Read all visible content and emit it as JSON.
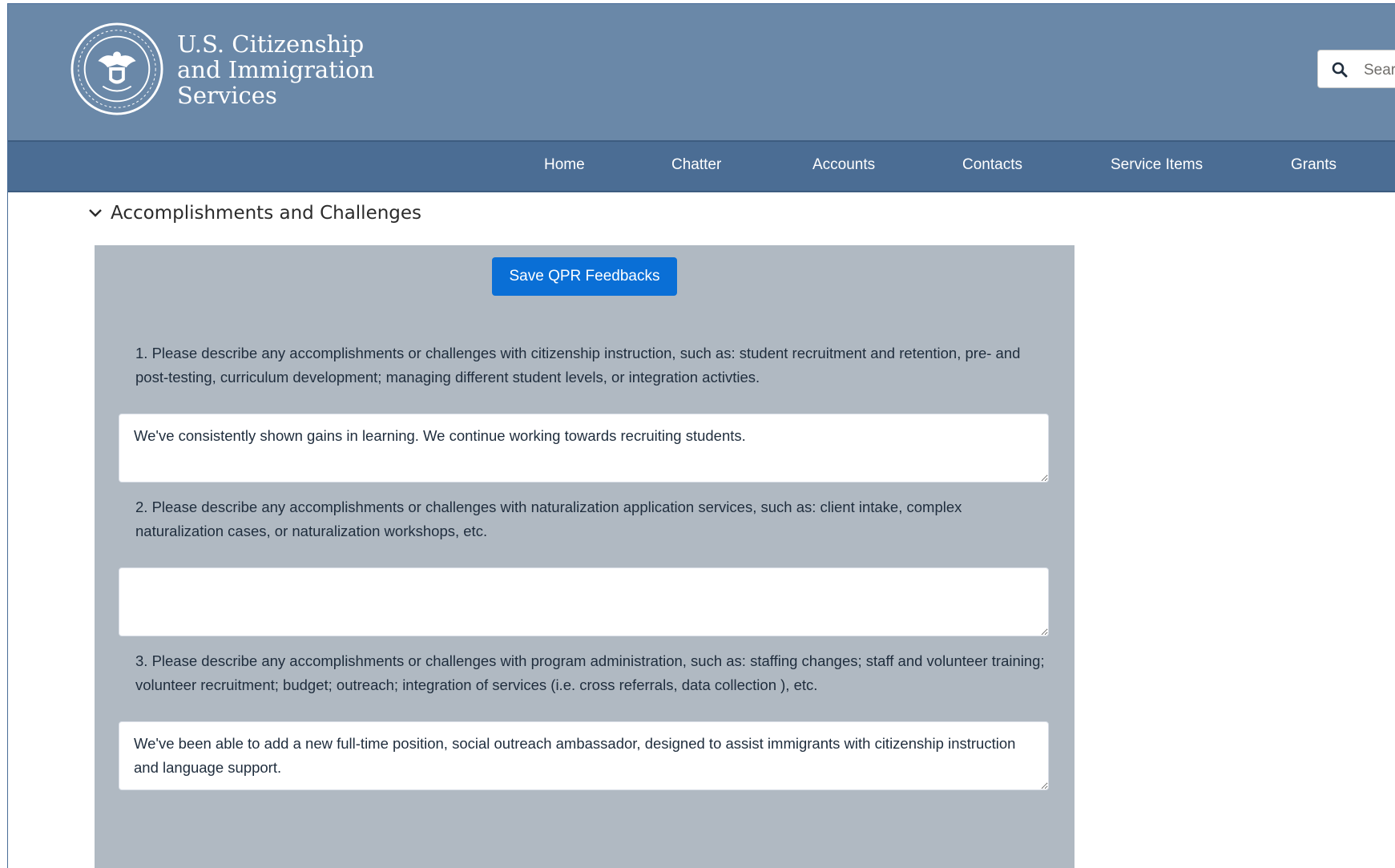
{
  "header": {
    "agency_line1": "U.S. Citizenship",
    "agency_line2": "and Immigration",
    "agency_line3": "Services",
    "search_placeholder": "Search..."
  },
  "nav": {
    "items": [
      "Home",
      "Chatter",
      "Accounts",
      "Contacts",
      "Service Items",
      "Grants"
    ]
  },
  "section": {
    "title": "Accomplishments and Challenges",
    "save_label": "Save QPR Feedbacks"
  },
  "questions": [
    {
      "text": "1. Please describe any accomplishments or challenges with citizenship instruction, such as: student recruitment and retention, pre- and post-testing, curriculum development; managing different student levels, or integration activties.",
      "answer": "We've consistently shown gains in learning. We continue working towards recruiting students."
    },
    {
      "text": "2. Please describe any accomplishments or challenges with naturalization application services, such as: client intake, complex naturalization cases, or naturalization workshops, etc.",
      "answer": ""
    },
    {
      "text": "3. Please describe any accomplishments or challenges with program administration, such as: staffing changes; staff and volunteer training; volunteer recruitment; budget; outreach; integration of services (i.e. cross referrals, data collection ), etc.",
      "answer": "We've been able to add a new full-time position, social outreach ambassador, designed to assist immigrants with citizenship instruction and language support."
    }
  ]
}
